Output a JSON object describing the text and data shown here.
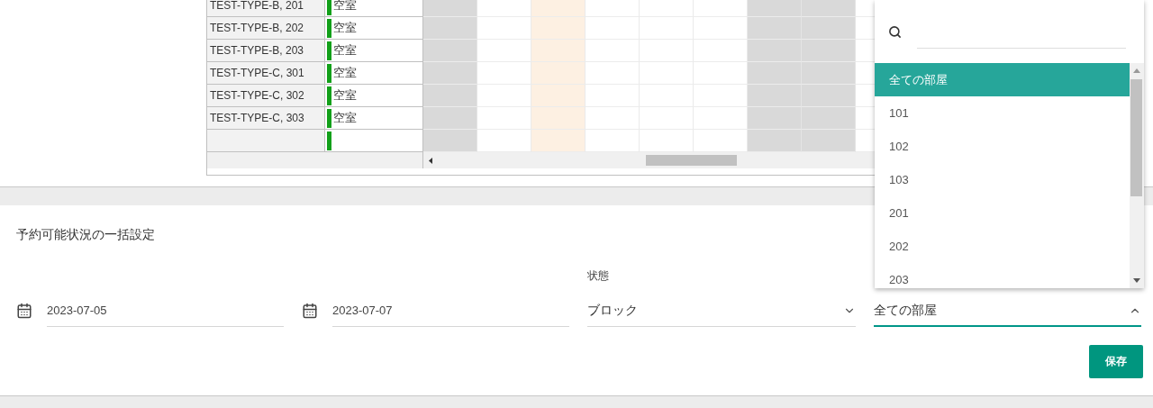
{
  "grid": {
    "rows": [
      {
        "kind": "room",
        "name": "TEST-TYPE-B, 201",
        "status": "空室"
      },
      {
        "kind": "room",
        "name": "TEST-TYPE-B, 202",
        "status": "空室"
      },
      {
        "kind": "room",
        "name": "TEST-TYPE-B, 203",
        "status": "空室"
      },
      {
        "kind": "room",
        "name": "TEST-TYPE-C, 301",
        "status": "空室"
      },
      {
        "kind": "room",
        "name": "TEST-TYPE-C, 302",
        "status": "空室"
      },
      {
        "kind": "room",
        "name": "TEST-TYPE-C, 303",
        "status": "空室"
      },
      {
        "kind": "empty"
      }
    ],
    "day_columns": [
      {
        "kind": "closed"
      },
      {
        "kind": "open"
      },
      {
        "kind": "today"
      },
      {
        "kind": "open"
      },
      {
        "kind": "open"
      },
      {
        "kind": "open"
      },
      {
        "kind": "closed"
      },
      {
        "kind": "closed"
      },
      {
        "kind": "open"
      }
    ]
  },
  "bulk_settings": {
    "title": "予約可能状況の一括設定",
    "start_date": {
      "value": "2023-07-05"
    },
    "end_date": {
      "value": "2023-07-07"
    },
    "state_select": {
      "label": "状態",
      "value": "ブロック"
    },
    "room_select": {
      "value": "全ての部屋",
      "open": true
    },
    "save_button": "保存"
  },
  "room_dropdown": {
    "items": [
      {
        "label": "全ての部屋",
        "selected": true
      },
      {
        "label": "101",
        "selected": false
      },
      {
        "label": "102",
        "selected": false
      },
      {
        "label": "103",
        "selected": false
      },
      {
        "label": "201",
        "selected": false
      },
      {
        "label": "202",
        "selected": false
      },
      {
        "label": "203",
        "selected": false
      }
    ]
  }
}
